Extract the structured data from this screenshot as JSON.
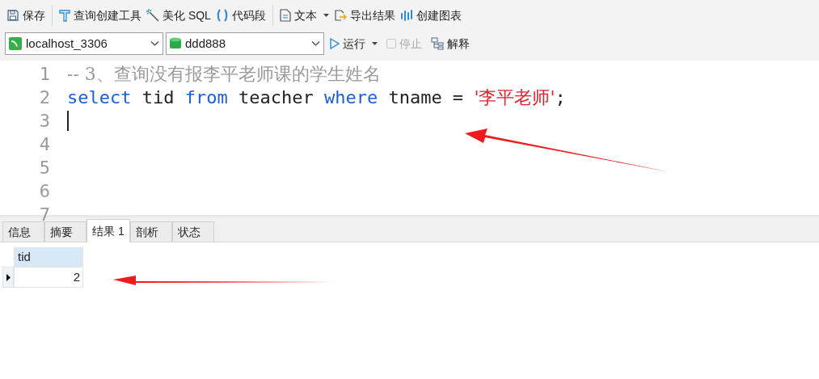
{
  "toolbar": [
    {
      "label": "保存",
      "caret": false
    },
    {
      "label": "查询创建工具",
      "caret": false
    },
    {
      "label": "美化 SQL",
      "caret": false
    },
    {
      "label": "代码段",
      "caret": false
    },
    {
      "label": "文本",
      "caret": true
    },
    {
      "label": "导出结果",
      "caret": false
    },
    {
      "label": "创建图表",
      "caret": false
    }
  ],
  "connection": {
    "value": "localhost_3306"
  },
  "database": {
    "value": "ddd888"
  },
  "actions": [
    {
      "label": "运行",
      "caret": true,
      "disabled": false
    },
    {
      "label": "停止",
      "caret": false,
      "disabled": true
    },
    {
      "label": "解释",
      "caret": false,
      "disabled": false
    }
  ],
  "editor": {
    "lines": [
      {
        "number": "1",
        "tokens": [
          {
            "kind": "comment",
            "text": "-- 3、查询没有报李平老师课的学生姓名"
          }
        ]
      },
      {
        "number": "2",
        "tokens": [
          {
            "kind": "keyword",
            "text": "select"
          },
          {
            "kind": "plain",
            "text": " tid "
          },
          {
            "kind": "keyword",
            "text": "from"
          },
          {
            "kind": "plain",
            "text": " teacher "
          },
          {
            "kind": "keyword",
            "text": "where"
          },
          {
            "kind": "plain",
            "text": " tname = "
          },
          {
            "kind": "string",
            "text": "'李平老师'"
          },
          {
            "kind": "plain",
            "text": ";"
          }
        ]
      },
      {
        "number": "3",
        "cursor": true
      },
      {
        "number": "4"
      },
      {
        "number": "5"
      },
      {
        "number": "6"
      },
      {
        "number": "7"
      }
    ]
  },
  "result_tabs": [
    {
      "label": "信息",
      "selected": false
    },
    {
      "label": "摘要",
      "selected": false
    },
    {
      "label": "结果 1",
      "selected": true
    },
    {
      "label": "剖析",
      "selected": false
    },
    {
      "label": "状态",
      "selected": false
    }
  ],
  "table": {
    "columns": [
      "tid"
    ],
    "rows": [
      {
        "cells": [
          "2"
        ],
        "current": true
      }
    ]
  }
}
